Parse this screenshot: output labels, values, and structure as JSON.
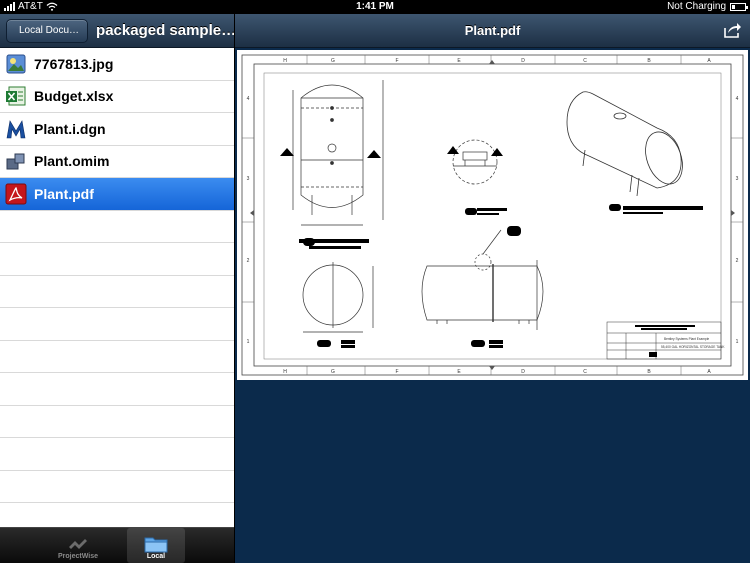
{
  "status_bar": {
    "carrier": "AT&T",
    "time": "1:41 PM",
    "charging": "Not Charging"
  },
  "left_nav": {
    "back_label": "Local Docu…",
    "title": "packaged sample…."
  },
  "files": [
    {
      "name": "7767813.jpg",
      "icon": "image-file-icon"
    },
    {
      "name": "Budget.xlsx",
      "icon": "excel-file-icon"
    },
    {
      "name": "Plant.i.dgn",
      "icon": "microstation-file-icon"
    },
    {
      "name": "Plant.omim",
      "icon": "model-file-icon"
    },
    {
      "name": "Plant.pdf",
      "icon": "pdf-file-icon",
      "selected": true
    }
  ],
  "tabs": [
    {
      "label": "ProjectWise",
      "icon": "projectwise-icon",
      "active": false
    },
    {
      "label": "Local",
      "icon": "folder-icon",
      "active": true
    }
  ],
  "document": {
    "title": "Plant.pdf",
    "column_labels": [
      "H",
      "G",
      "F",
      "E",
      "D",
      "C",
      "B",
      "A"
    ],
    "row_labels": [
      "4",
      "3",
      "2",
      "1"
    ],
    "title_block_label": "Bentley Systems Plant Example",
    "title_block_item": "55,400 GAL HORIZONTAL STORAGE TANK"
  },
  "colors": {
    "nav_top": "#3e5670",
    "nav_bottom": "#1d2f44",
    "selected": "#1e74e4",
    "doc_bg": "#0b2a4b"
  }
}
